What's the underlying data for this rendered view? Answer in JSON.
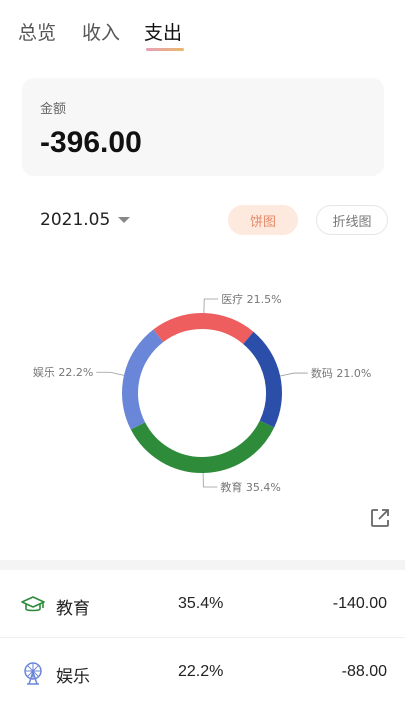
{
  "tabs": [
    {
      "label": "总览",
      "active": false
    },
    {
      "label": "收入",
      "active": false
    },
    {
      "label": "支出",
      "active": true
    }
  ],
  "summary": {
    "label": "金额",
    "value": "-396.00"
  },
  "filter": {
    "month": "2021.05",
    "chart_toggle": [
      {
        "label": "饼图",
        "selected": true
      },
      {
        "label": "折线图",
        "selected": false
      }
    ]
  },
  "chart_data": {
    "type": "pie",
    "style": "donut",
    "slices": [
      {
        "name": "教育",
        "percent": 35.4,
        "label": "教育 35.4%",
        "color": "#2e8b3a"
      },
      {
        "name": "娱乐",
        "percent": 22.2,
        "label": "娱乐 22.2%",
        "color": "#6a86d8"
      },
      {
        "name": "医疗",
        "percent": 21.5,
        "label": "医疗 21.5%",
        "color": "#ef5e5e"
      },
      {
        "name": "数码",
        "percent": 21.0,
        "label": "数码 21.0%",
        "color": "#2b4ea8"
      }
    ]
  },
  "share": {
    "icon": "share-icon"
  },
  "categories": [
    {
      "name": "教育",
      "percent": "35.4%",
      "amount": "-140.00",
      "icon": "graduation-cap-icon",
      "color": "#2e8b3a"
    },
    {
      "name": "娱乐",
      "percent": "22.2%",
      "amount": "-88.00",
      "icon": "ferris-wheel-icon",
      "color": "#6a86d8"
    }
  ]
}
